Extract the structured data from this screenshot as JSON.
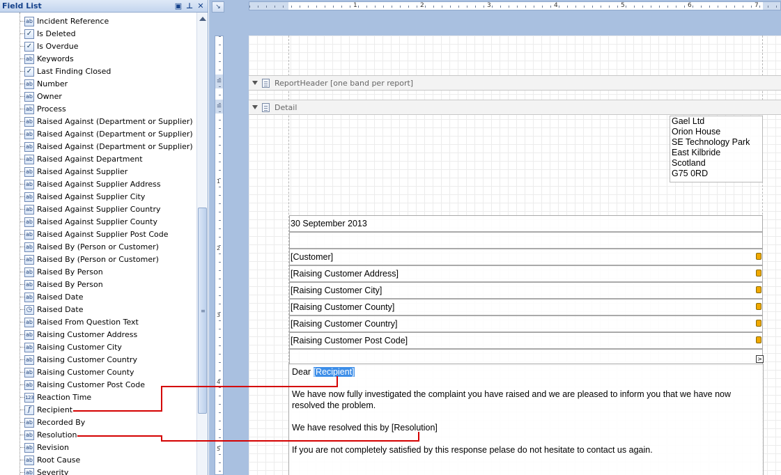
{
  "field_list": {
    "title": "Field List",
    "items": [
      {
        "label": "Incident Reference",
        "icon": "ab"
      },
      {
        "label": "Is Deleted",
        "icon": "✓"
      },
      {
        "label": "Is Overdue",
        "icon": "✓"
      },
      {
        "label": "Keywords",
        "icon": "ab"
      },
      {
        "label": "Last Finding Closed",
        "icon": "✓"
      },
      {
        "label": "Number",
        "icon": "ab"
      },
      {
        "label": "Owner",
        "icon": "ab"
      },
      {
        "label": "Process",
        "icon": "ab"
      },
      {
        "label": "Raised Against (Department or Supplier)",
        "icon": "ab"
      },
      {
        "label": "Raised Against (Department or Supplier)",
        "icon": "ab"
      },
      {
        "label": "Raised Against (Department or Supplier)",
        "icon": "ab"
      },
      {
        "label": "Raised Against Department",
        "icon": "ab"
      },
      {
        "label": "Raised Against Supplier",
        "icon": "ab"
      },
      {
        "label": "Raised Against Supplier Address",
        "icon": "ab"
      },
      {
        "label": "Raised Against Supplier City",
        "icon": "ab"
      },
      {
        "label": "Raised Against Supplier Country",
        "icon": "ab"
      },
      {
        "label": "Raised Against Supplier County",
        "icon": "ab"
      },
      {
        "label": "Raised Against Supplier Post Code",
        "icon": "ab"
      },
      {
        "label": "Raised By (Person or Customer)",
        "icon": "ab"
      },
      {
        "label": "Raised By (Person or Customer)",
        "icon": "ab"
      },
      {
        "label": "Raised By Person",
        "icon": "ab"
      },
      {
        "label": "Raised By Person",
        "icon": "ab"
      },
      {
        "label": "Raised Date",
        "icon": "ab"
      },
      {
        "label": "Raised Date",
        "icon": "◷"
      },
      {
        "label": "Raised From Question Text",
        "icon": "ab"
      },
      {
        "label": "Raising Customer Address",
        "icon": "ab"
      },
      {
        "label": "Raising Customer City",
        "icon": "ab"
      },
      {
        "label": "Raising Customer Country",
        "icon": "ab"
      },
      {
        "label": "Raising Customer County",
        "icon": "ab"
      },
      {
        "label": "Raising Customer Post Code",
        "icon": "ab"
      },
      {
        "label": "Reaction Time",
        "icon": "123"
      },
      {
        "label": "Recipient",
        "icon": "f"
      },
      {
        "label": "Recorded By",
        "icon": "ab"
      },
      {
        "label": "Resolution",
        "icon": "ab"
      },
      {
        "label": "Revision",
        "icon": "ab"
      },
      {
        "label": "Root Cause",
        "icon": "ab"
      },
      {
        "label": "Severity",
        "icon": "ab"
      }
    ]
  },
  "designer": {
    "ruler_numbers": [
      "1",
      "2",
      "3",
      "4",
      "5",
      "6",
      "7"
    ],
    "vruler_numbers": [
      "1",
      "2",
      "3",
      "4",
      "5"
    ],
    "bands": {
      "report_header": "ReportHeader [one band per report]",
      "detail": "Detail"
    },
    "address_lines": [
      "Gael Ltd",
      "Orion House",
      "SE Technology Park",
      "East Kilbride",
      "Scotland",
      "G75 0RD"
    ],
    "date": "30 September 2013",
    "customer_fields": [
      "[Customer]",
      "[Raising Customer Address]",
      "[Raising Customer City]",
      "[Raising Customer County]",
      "[Raising Customer Country]",
      "[Raising Customer Post Code]"
    ],
    "letter": {
      "dear": "Dear",
      "recipient_field": "[Recipient]",
      "para1_line1": "We have now fully investigated the complaint you have raised and we are pleased to inform you that we have now",
      "para1_line2": "resolved the problem.",
      "para2": "We have resolved this by [Resolution]",
      "para3": "If you are not completely satisfied by this response pelase do not hesitate to contact us again."
    },
    "connector_color": "#d40000"
  }
}
